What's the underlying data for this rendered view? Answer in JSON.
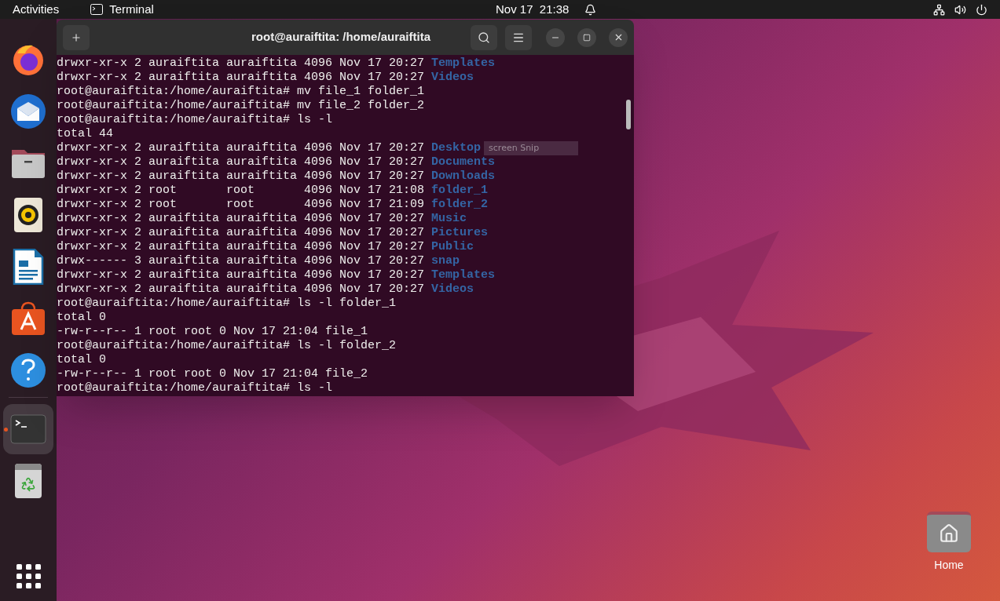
{
  "top_bar": {
    "activities": "Activities",
    "app_name": "Terminal",
    "date": "Nov 17",
    "time": "21:38"
  },
  "dock": {
    "items": [
      {
        "kind": "browser",
        "running": false
      },
      {
        "kind": "mail",
        "running": false
      },
      {
        "kind": "files",
        "running": false
      },
      {
        "kind": "music",
        "running": false
      },
      {
        "kind": "writer",
        "running": false
      },
      {
        "kind": "store",
        "running": false
      },
      {
        "kind": "help",
        "running": false
      },
      {
        "kind": "terminal",
        "running": true
      },
      {
        "kind": "trash",
        "running": false
      }
    ]
  },
  "terminal": {
    "title": "root@auraiftita: /home/auraiftita",
    "lines": [
      {
        "text": "drwxr-xr-x 2 auraiftita auraiftita 4096 Nov 17 20:27 ",
        "entry": "Templates"
      },
      {
        "text": "drwxr-xr-x 2 auraiftita auraiftita 4096 Nov 17 20:27 ",
        "entry": "Videos"
      },
      {
        "text": "root@auraiftita:/home/auraiftita# mv file_1 folder_1"
      },
      {
        "text": "root@auraiftita:/home/auraiftita# mv file_2 folder_2"
      },
      {
        "text": "root@auraiftita:/home/auraiftita# ls -l"
      },
      {
        "text": "total 44"
      },
      {
        "text": "drwxr-xr-x 2 auraiftita auraiftita 4096 Nov 17 20:27 ",
        "entry": "Desktop"
      },
      {
        "text": "drwxr-xr-x 2 auraiftita auraiftita 4096 Nov 17 20:27 ",
        "entry": "Documents"
      },
      {
        "text": "drwxr-xr-x 2 auraiftita auraiftita 4096 Nov 17 20:27 ",
        "entry": "Downloads"
      },
      {
        "text": "drwxr-xr-x 2 root       root       4096 Nov 17 21:08 ",
        "entry": "folder_1"
      },
      {
        "text": "drwxr-xr-x 2 root       root       4096 Nov 17 21:09 ",
        "entry": "folder_2"
      },
      {
        "text": "drwxr-xr-x 2 auraiftita auraiftita 4096 Nov 17 20:27 ",
        "entry": "Music"
      },
      {
        "text": "drwxr-xr-x 2 auraiftita auraiftita 4096 Nov 17 20:27 ",
        "entry": "Pictures"
      },
      {
        "text": "drwxr-xr-x 2 auraiftita auraiftita 4096 Nov 17 20:27 ",
        "entry": "Public"
      },
      {
        "text": "drwx------ 3 auraiftita auraiftita 4096 Nov 17 20:27 ",
        "entry": "snap"
      },
      {
        "text": "drwxr-xr-x 2 auraiftita auraiftita 4096 Nov 17 20:27 ",
        "entry": "Templates"
      },
      {
        "text": "drwxr-xr-x 2 auraiftita auraiftita 4096 Nov 17 20:27 ",
        "entry": "Videos"
      },
      {
        "text": "root@auraiftita:/home/auraiftita# ls -l folder_1"
      },
      {
        "text": "total 0"
      },
      {
        "text": "-rw-r--r-- 1 root root 0 Nov 17 21:04 file_1"
      },
      {
        "text": "root@auraiftita:/home/auraiftita# ls -l folder_2"
      },
      {
        "text": "total 0"
      },
      {
        "text": "-rw-r--r-- 1 root root 0 Nov 17 21:04 file_2"
      },
      {
        "text": "root@auraiftita:/home/auraiftita# ls -l"
      }
    ]
  },
  "snip_tooltip": "screen Snip",
  "desktop_icons": [
    {
      "label": "Home"
    }
  ]
}
